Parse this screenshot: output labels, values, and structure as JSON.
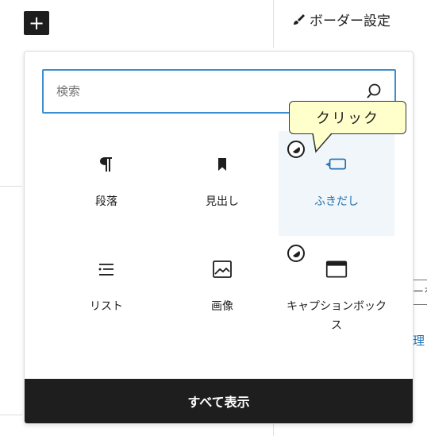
{
  "toolbar": {
    "add_symbol": "+"
  },
  "side_panel": {
    "border_setting_label": "ボーダー設定",
    "peek_box_text": "ーを",
    "peek_link_text": "理く"
  },
  "inserter": {
    "search_placeholder": "検索",
    "blocks": [
      {
        "label": "段落",
        "icon": "paragraph-icon"
      },
      {
        "label": "見出し",
        "icon": "bookmark-icon"
      },
      {
        "label": "ふきだし",
        "icon": "speech-bubble-icon",
        "selected": true
      },
      {
        "label": "リスト",
        "icon": "list-icon"
      },
      {
        "label": "画像",
        "icon": "image-icon"
      },
      {
        "label": "キャプションボックス",
        "icon": "caption-box-icon"
      }
    ],
    "show_all_label": "すべて表示"
  },
  "annotation": {
    "tooltip_text": "クリック"
  },
  "colors": {
    "accent": "#2271b1",
    "search_border": "#3b8ed0",
    "selected_bg": "#f0f6fa",
    "dark": "#1e1e1e",
    "tooltip_bg": "#ffffcc"
  }
}
